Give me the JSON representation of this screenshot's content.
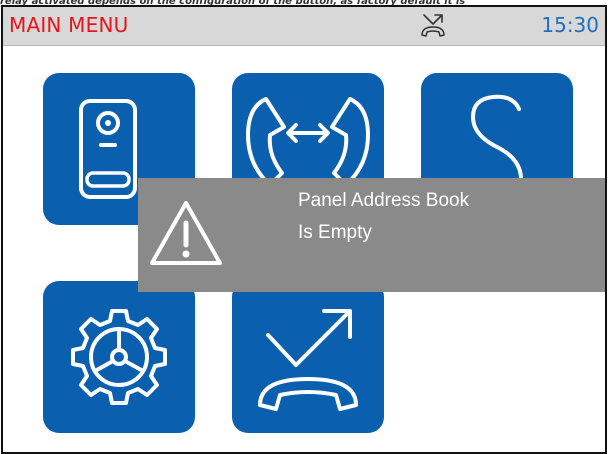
{
  "caption": "relay activated depends on the configuration of the button, as factory default it is",
  "header": {
    "title": "MAIN MENU",
    "status_icon": "missed-call-icon",
    "time": "15:30"
  },
  "tiles": [
    {
      "icon": "door-panel-icon"
    },
    {
      "icon": "intercom-call-icon"
    },
    {
      "icon": "address-book-icon"
    },
    {
      "icon": "settings-gear-icon"
    },
    {
      "icon": "call-forward-icon"
    }
  ],
  "popup": {
    "icon": "warning-icon",
    "line1": "Panel Address Book",
    "line2": "Is Empty"
  },
  "colors": {
    "accent_red": "#e3171d",
    "tile_blue": "#0a5fae",
    "clock_blue": "#1f6fc0",
    "popup_gray": "#8a8a8a"
  }
}
